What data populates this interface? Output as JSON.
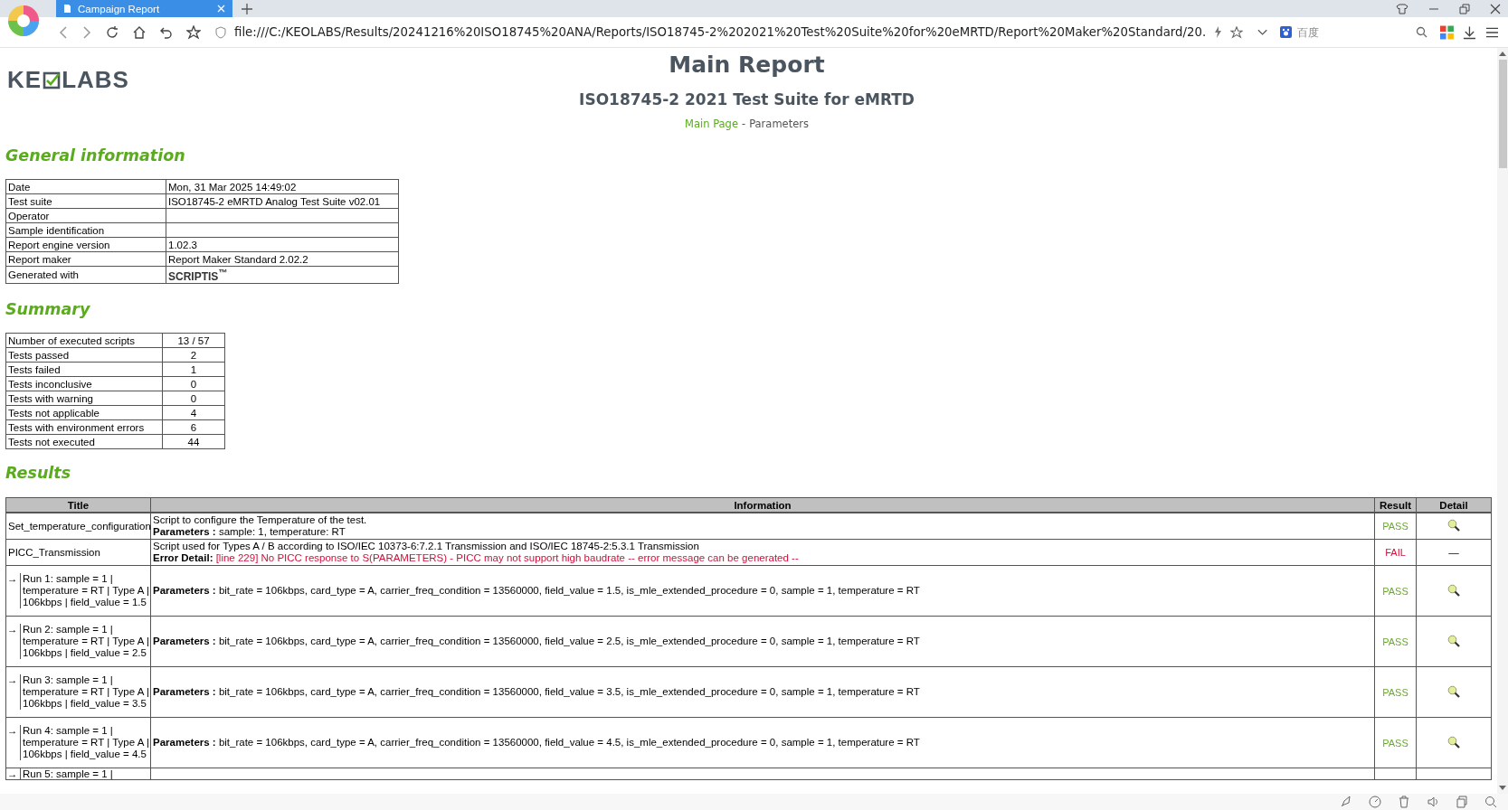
{
  "browser": {
    "tab_title": "Campaign Report",
    "url": "file:///C:/KEOLABS/Results/20241216%20ISO18745%20ANA/Reports/ISO18745-2%202021%20Test%20Suite%20for%20eMRTD/Report%20Maker%20Standard/20.",
    "search_placeholder": "百度"
  },
  "header": {
    "logo_start": "KE",
    "logo_end": "LABS",
    "title": "Main Report",
    "subtitle": "ISO18745-2 2021 Test Suite for eMRTD",
    "nav": [
      {
        "label": "Main Page",
        "kind": "link"
      },
      {
        "label": "-",
        "kind": "separator"
      },
      {
        "label": "Parameters",
        "kind": "text"
      }
    ]
  },
  "general_information": {
    "heading": "General information",
    "rows": [
      {
        "label": "Date",
        "value": "Mon, 31 Mar 2025 14:49:02"
      },
      {
        "label": "Test suite",
        "value": "ISO18745-2 eMRTD Analog Test Suite v02.01"
      },
      {
        "label": "Operator"
      },
      {
        "label": "Sample identification"
      },
      {
        "label": "Report engine version",
        "value": "1.02.3"
      },
      {
        "label": "Report maker",
        "value": "Report Maker Standard 2.02.2"
      },
      {
        "label": "Generated with",
        "value": "SCRIPTIS$^{™}$",
        "kind": "brand"
      }
    ]
  },
  "summary": {
    "heading": "Summary",
    "rows": [
      {
        "label": "Number of executed scripts",
        "value": "13 / 57"
      },
      {
        "label": "Tests passed",
        "value": "2"
      },
      {
        "label": "Tests failed",
        "value": "1"
      },
      {
        "label": "Tests inconclusive",
        "value": "0"
      },
      {
        "label": "Tests with warning",
        "value": "0"
      },
      {
        "label": "Tests not applicable",
        "value": "4"
      },
      {
        "label": "Tests with environment errors",
        "value": "6"
      },
      {
        "label": "Tests not executed",
        "value": "44"
      }
    ]
  },
  "results": {
    "heading": "Results",
    "columns": [
      "Title",
      "Information",
      "Result",
      "Detail"
    ],
    "rows": [
      {
        "kind": "script",
        "title": "Set_temperature_configuration",
        "description": "Script to configure the Temperature of the test.",
        "note": {
          "kind": "parameters",
          "label": "Parameters :",
          "text": "sample: 1, temperature: RT"
        },
        "result": "PASS",
        "failed": false,
        "detail": {
          "kind": "icon"
        }
      },
      {
        "kind": "script",
        "title": "PICC_Transmission",
        "description": "Script used for Types A / B according to ISO/IEC 10373-6:7.2.1 Transmission and ISO/IEC 18745-2:5.3.1 Transmission",
        "note": {
          "kind": "error",
          "label": "Error Detail:",
          "text": "[line 229] No PICC response to S(PARAMETERS) - PICC may not support high baudrate -- error message can be generated --"
        },
        "result": "FAIL",
        "failed": true,
        "detail": {
          "kind": "text",
          "text": "—"
        }
      },
      {
        "kind": "run",
        "arrow": "→",
        "title": "Run 1: sample = 1 | temperature = RT | Type A | 106kbps | field_value = 1.5",
        "note": {
          "kind": "parameters",
          "label": "Parameters :",
          "text": "bit_rate = 106kbps, card_type = A, carrier_freq_condition = 13560000, field_value = 1.5, is_mle_extended_procedure = 0, sample = 1, temperature = RT"
        },
        "result": "PASS",
        "failed": false,
        "detail": {
          "kind": "icon"
        }
      },
      {
        "kind": "run",
        "arrow": "→",
        "title": "Run 2: sample = 1 | temperature = RT | Type A | 106kbps | field_value = 2.5",
        "note": {
          "kind": "parameters",
          "label": "Parameters :",
          "text": "bit_rate = 106kbps, card_type = A, carrier_freq_condition = 13560000, field_value = 2.5, is_mle_extended_procedure = 0, sample = 1, temperature = RT"
        },
        "result": "PASS",
        "failed": false,
        "detail": {
          "kind": "icon"
        }
      },
      {
        "kind": "run",
        "arrow": "→",
        "title": "Run 3: sample = 1 | temperature = RT | Type A | 106kbps | field_value = 3.5",
        "note": {
          "kind": "parameters",
          "label": "Parameters :",
          "text": "bit_rate = 106kbps, card_type = A, carrier_freq_condition = 13560000, field_value = 3.5, is_mle_extended_procedure = 0, sample = 1, temperature = RT"
        },
        "result": "PASS",
        "failed": false,
        "detail": {
          "kind": "icon"
        }
      },
      {
        "kind": "run",
        "arrow": "→",
        "title": "Run 4: sample = 1 | temperature = RT | Type A | 106kbps | field_value = 4.5",
        "note": {
          "kind": "parameters",
          "label": "Parameters :",
          "text": "bit_rate = 106kbps, card_type = A, carrier_freq_condition = 13560000, field_value = 4.5, is_mle_extended_procedure = 0, sample = 1, temperature = RT"
        },
        "result": "PASS",
        "failed": false,
        "detail": {
          "kind": "icon"
        }
      },
      {
        "kind": "partial",
        "arrow": "→",
        "title": "Run 5: sample = 1 |"
      }
    ]
  }
}
